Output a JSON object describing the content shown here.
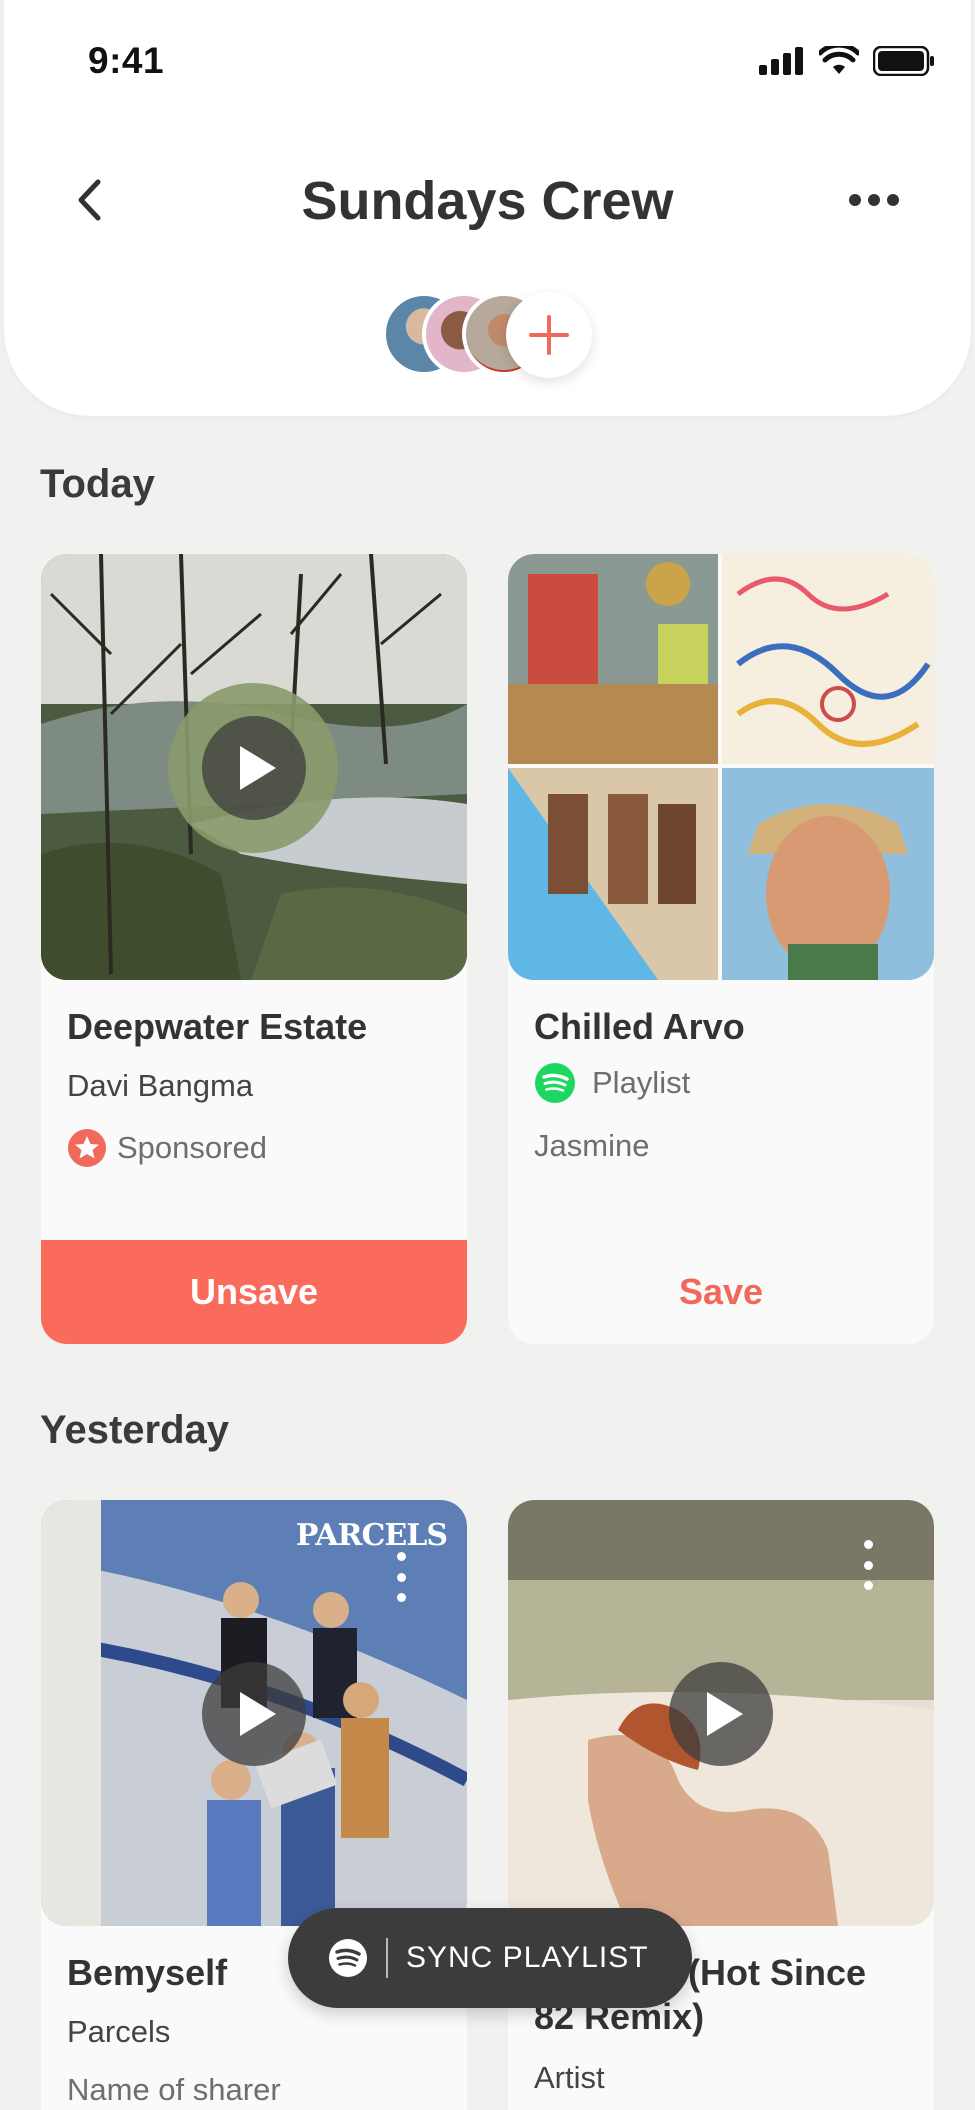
{
  "status_bar": {
    "time": "9:41"
  },
  "header": {
    "title": "Sundays Crew"
  },
  "sections": [
    {
      "title": "Today"
    },
    {
      "title": "Yesterday"
    }
  ],
  "cards": {
    "deepwater": {
      "title": "Deepwater Estate",
      "artist": "Davi Bangma",
      "badge": "Sponsored",
      "action": "Unsave"
    },
    "chilled": {
      "title": "Chilled Arvo",
      "type": "Playlist",
      "sharer": "Jasmine",
      "action": "Save"
    },
    "bemyself": {
      "title": "Bemyself",
      "artist": "Parcels",
      "sharer": "Name of sharer",
      "art_text": "PARCELS"
    },
    "remix": {
      "title_line1": "(Hot Since",
      "title_line2": "82 Remix)",
      "artist": "Artist"
    }
  },
  "sync_button": {
    "label": "SYNC PLAYLIST"
  },
  "colors": {
    "accent": "#fb6b5b",
    "spotify": "#1ed760",
    "background": "#f1f1ef"
  }
}
